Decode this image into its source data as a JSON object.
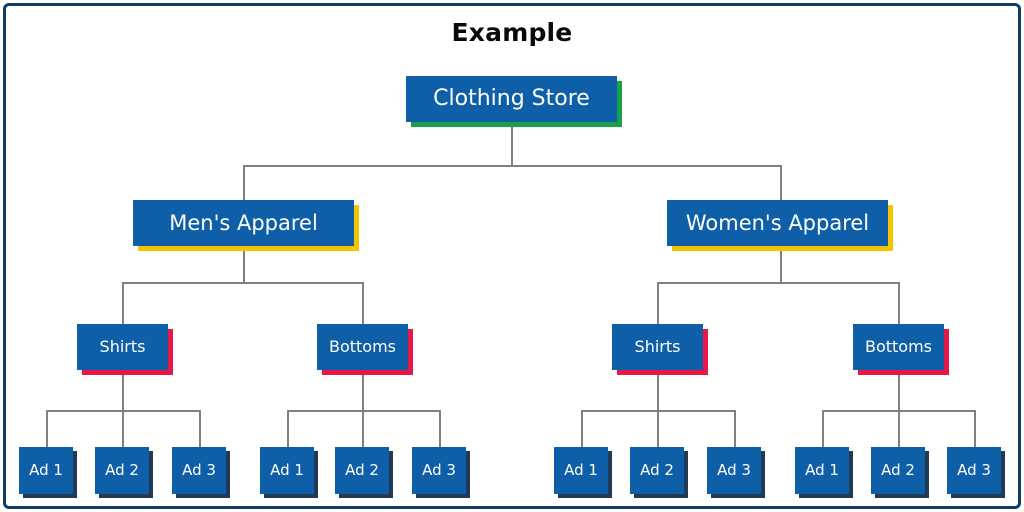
{
  "diagram": {
    "title": "Example",
    "type": "hierarchy-tree",
    "colors": {
      "frame_border": "#123c63",
      "node_fill": "#0e5fa8",
      "node_text": "#ffffff",
      "connector": "#808080",
      "root_shadow": "#1aa04a",
      "level2_shadow": "#f4c400",
      "level3_shadow": "#e8174a",
      "leaf_shadow": "#1f3b55",
      "title_text": "#0a0a0a",
      "background": "#ffffff"
    },
    "root": {
      "label": "Clothing Store"
    },
    "level2": [
      {
        "label": "Men's Apparel"
      },
      {
        "label": "Women's Apparel"
      }
    ],
    "level3": [
      {
        "label": "Shirts"
      },
      {
        "label": "Bottoms"
      },
      {
        "label": "Shirts"
      },
      {
        "label": "Bottoms"
      }
    ],
    "leaves": [
      {
        "label": "Ad 1"
      },
      {
        "label": "Ad 2"
      },
      {
        "label": "Ad 3"
      },
      {
        "label": "Ad 1"
      },
      {
        "label": "Ad 2"
      },
      {
        "label": "Ad 3"
      },
      {
        "label": "Ad 1"
      },
      {
        "label": "Ad 2"
      },
      {
        "label": "Ad 3"
      },
      {
        "label": "Ad 1"
      },
      {
        "label": "Ad 2"
      },
      {
        "label": "Ad 3"
      }
    ]
  }
}
